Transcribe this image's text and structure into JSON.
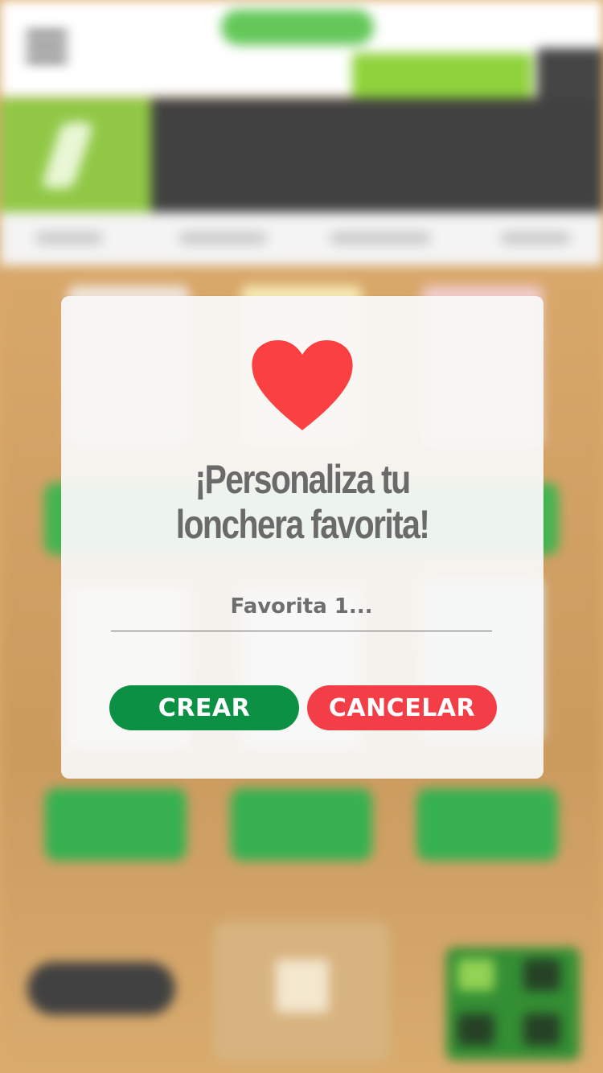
{
  "modal": {
    "icon": "heart-icon",
    "title_line1": "¡Personaliza tu",
    "title_line2": "lonchera favorita!",
    "input_placeholder": "Favorita 1...",
    "input_value": "",
    "create_label": "CREAR",
    "cancel_label": "CANCELAR"
  },
  "colors": {
    "heart": "#fa4042",
    "create_button": "#0b9044",
    "cancel_button": "#f33e47",
    "title_text": "#6a6a6a",
    "modal_background": "#f8f8f6"
  },
  "background": {
    "blurred": true,
    "header_icons": [
      "menu-icon",
      "logo"
    ]
  }
}
